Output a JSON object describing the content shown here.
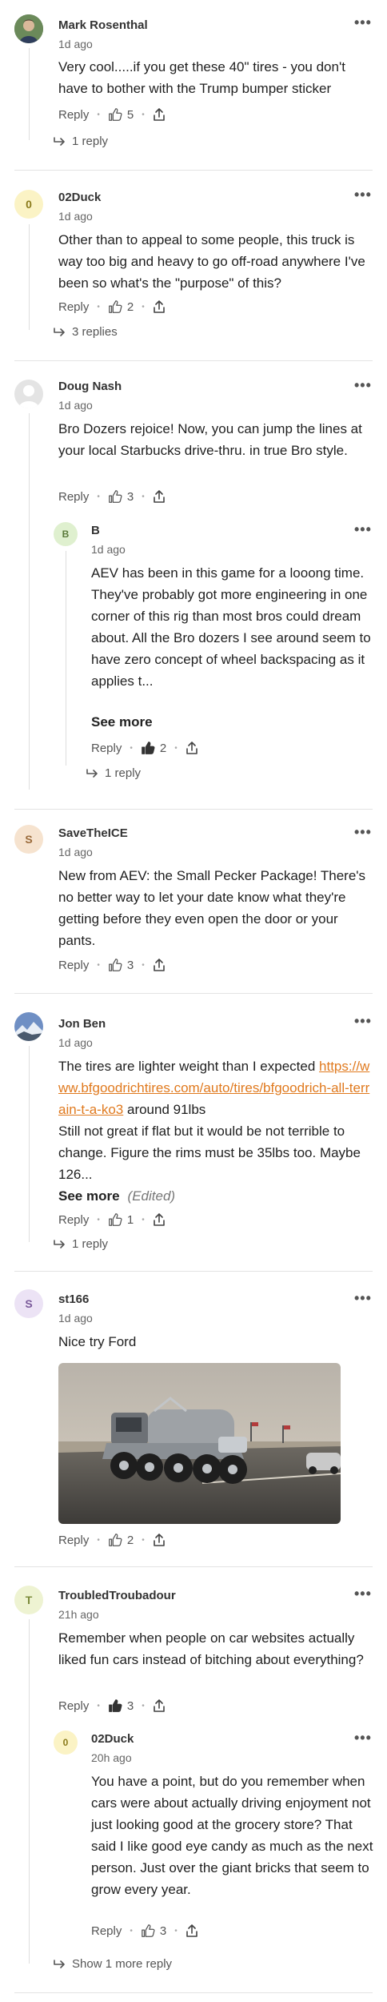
{
  "labels": {
    "reply": "Reply",
    "see_more": "See more",
    "edited": "(Edited)"
  },
  "comments": [
    {
      "author": "Mark Rosenthal",
      "time": "1d ago",
      "avatar_letter": "",
      "text": "Very cool.....if you get these 40\" tires - you don't have to bother with the Trump bumper sticker",
      "likes": "5",
      "replies": "1 reply"
    },
    {
      "author": "02Duck",
      "time": "1d ago",
      "avatar_letter": "0",
      "text": "Other than to appeal to some people, this truck is way too big and heavy to go off-road anywhere I've been so what's the \"purpose\" of this?",
      "likes": "2",
      "replies": "3 replies"
    },
    {
      "author": "Doug Nash",
      "time": "1d ago",
      "avatar_letter": "",
      "text": "Bro Dozers rejoice! Now, you can jump the lines at your local Starbucks drive-thru. in true Bro style.",
      "likes": "3"
    },
    {
      "author": "B",
      "time": "1d ago",
      "avatar_letter": "B",
      "text": "AEV has been in this game for a looong time.  They've probably got more engineering in one corner of this rig than most bros could dream about.  All the Bro dozers I see around seem to have zero concept of wheel backspacing as it applies t...",
      "likes": "2",
      "replies": "1 reply"
    },
    {
      "author": "SaveTheICE",
      "time": "1d ago",
      "avatar_letter": "S",
      "text": "New from AEV: the Small Pecker Package! There's no better way to let your date know what they're getting before they even open the door or your pants.",
      "likes": "3"
    },
    {
      "author": "Jon Ben",
      "time": "1d ago",
      "avatar_letter": "",
      "text_before": "The tires are lighter weight than I expected ",
      "link": "https://www.bfgoodrichtires.com/auto/tires/bfgoodrich-all-terrain-t-a-ko3",
      "text_after": " around 91lbs",
      "text2": "Still not great if flat but it would be not terrible to change. Figure the rims must be 35lbs too. Maybe 126...",
      "likes": "1",
      "replies": "1 reply"
    },
    {
      "author": "st166",
      "time": "1d ago",
      "avatar_letter": "S",
      "text": "Nice try Ford",
      "likes": "2"
    },
    {
      "author": "TroubledTroubadour",
      "time": "21h ago",
      "avatar_letter": "T",
      "text": "Remember when people on car websites actually liked fun cars instead of bitching about everything?",
      "likes": "3"
    },
    {
      "author": "02Duck",
      "time": "20h ago",
      "avatar_letter": "0",
      "text": "You have a point, but do you remember when cars were about actually driving enjoyment not just looking good at the grocery store?  That said I like good eye candy as much as the next person.  Just over the giant bricks that seem to grow every year.",
      "likes": "3",
      "replies": "Show 1 more reply"
    }
  ]
}
